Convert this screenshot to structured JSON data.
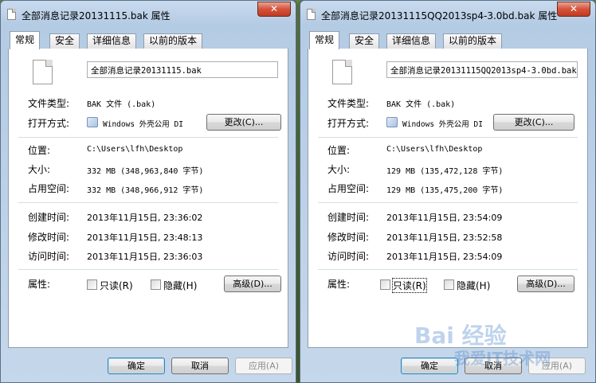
{
  "dialogs": [
    {
      "title": "全部消息记录20131115.bak 属性",
      "close_label": "✕",
      "tabs": [
        "常规",
        "安全",
        "详细信息",
        "以前的版本"
      ],
      "filename": "全部消息记录20131115.bak",
      "labels": {
        "type": "文件类型:",
        "opens_with": "打开方式:",
        "location": "位置:",
        "size": "大小:",
        "size_on_disk": "占用空间:",
        "created": "创建时间:",
        "modified": "修改时间:",
        "accessed": "访问时间:",
        "attributes": "属性:"
      },
      "file_type": "BAK 文件 (.bak)",
      "opens_with_app": "Windows 外壳公用 DI",
      "change_button": "更改(C)...",
      "location": "C:\\Users\\lfh\\Desktop",
      "size": "332 MB (348,963,840 字节)",
      "size_on_disk": "332 MB (348,966,912 字节)",
      "created": "2013年11月15日, 23:36:02",
      "modified": "2013年11月15日, 23:48:13",
      "accessed": "2013年11月15日, 23:36:03",
      "readonly_label": "只读(R)",
      "hidden_label": "隐藏(H)",
      "advanced_button": "高级(D)...",
      "ok_button": "确定",
      "cancel_button": "取消",
      "apply_button": "应用(A)"
    },
    {
      "title": "全部消息记录20131115QQ2013sp4-3.0bd.bak 属性",
      "close_label": "✕",
      "tabs": [
        "常规",
        "安全",
        "详细信息",
        "以前的版本"
      ],
      "filename": "全部消息记录20131115QQ2013sp4-3.0bd.bak",
      "labels": {
        "type": "文件类型:",
        "opens_with": "打开方式:",
        "location": "位置:",
        "size": "大小:",
        "size_on_disk": "占用空间:",
        "created": "创建时间:",
        "modified": "修改时间:",
        "accessed": "访问时间:",
        "attributes": "属性:"
      },
      "file_type": "BAK 文件 (.bak)",
      "opens_with_app": "Windows 外壳公用 DI",
      "change_button": "更改(C)...",
      "location": "C:\\Users\\lfh\\Desktop",
      "size": "129 MB (135,472,128 字节)",
      "size_on_disk": "129 MB (135,475,200 字节)",
      "created": "2013年11月15日, 23:54:09",
      "modified": "2013年11月15日, 23:52:58",
      "accessed": "2013年11月15日, 23:54:09",
      "readonly_label": "只读(R)",
      "hidden_label": "隐藏(H)",
      "advanced_button": "高级(D)...",
      "ok_button": "确定",
      "cancel_button": "取消",
      "apply_button": "应用(A)"
    }
  ],
  "watermark": "Bai 经验",
  "watermark2": "我爱IT技术网"
}
